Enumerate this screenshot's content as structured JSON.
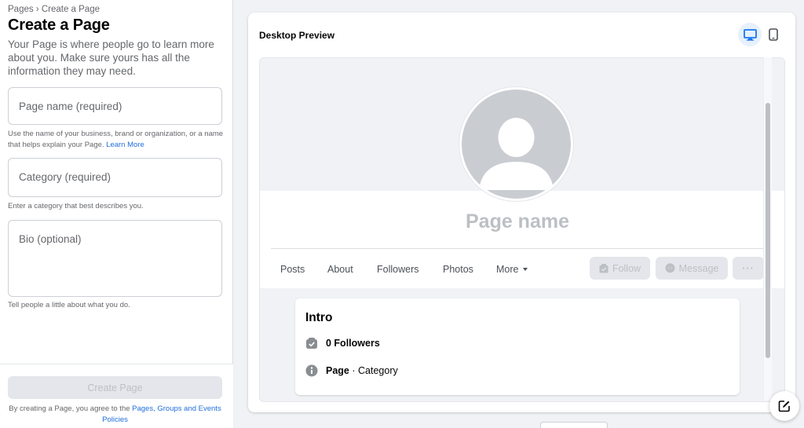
{
  "left": {
    "breadcrumb": "Pages › Create a Page",
    "title": "Create a Page",
    "intro": "Your Page is where people go to learn more about you. Make sure yours has all the information they may need.",
    "page_name_placeholder": "Page name (required)",
    "page_name_help": "Use the name of your business, brand or organization, or a name that helps explain your Page.",
    "learn_more": "Learn More",
    "category_placeholder": "Category (required)",
    "category_help": "Enter a category that best describes you.",
    "bio_placeholder": "Bio (optional)",
    "bio_help": "Tell people a little about what you do.",
    "create_button": "Create Page",
    "terms_prefix": "By creating a Page, you agree to the",
    "terms_link": "Pages, Groups and Events Policies"
  },
  "preview": {
    "title": "Desktop Preview",
    "page_name": "Page name",
    "tabs": [
      "Posts",
      "About",
      "Followers",
      "Photos",
      "More"
    ],
    "follow": "Follow",
    "message": "Message",
    "more_actions": "···",
    "intro_title": "Intro",
    "followers": "0 Followers",
    "page_label": "Page",
    "category_label": "· Category"
  },
  "colors": {
    "accent": "#1877f2",
    "link": "#216fdb",
    "disabled_bg": "#e4e6eb",
    "disabled_text": "#bcc0c4"
  },
  "icons": [
    "desktop-icon",
    "mobile-icon",
    "avatar-silhouette-icon",
    "follow-icon",
    "messenger-icon",
    "followers-icon",
    "info-icon",
    "compose-icon"
  ]
}
